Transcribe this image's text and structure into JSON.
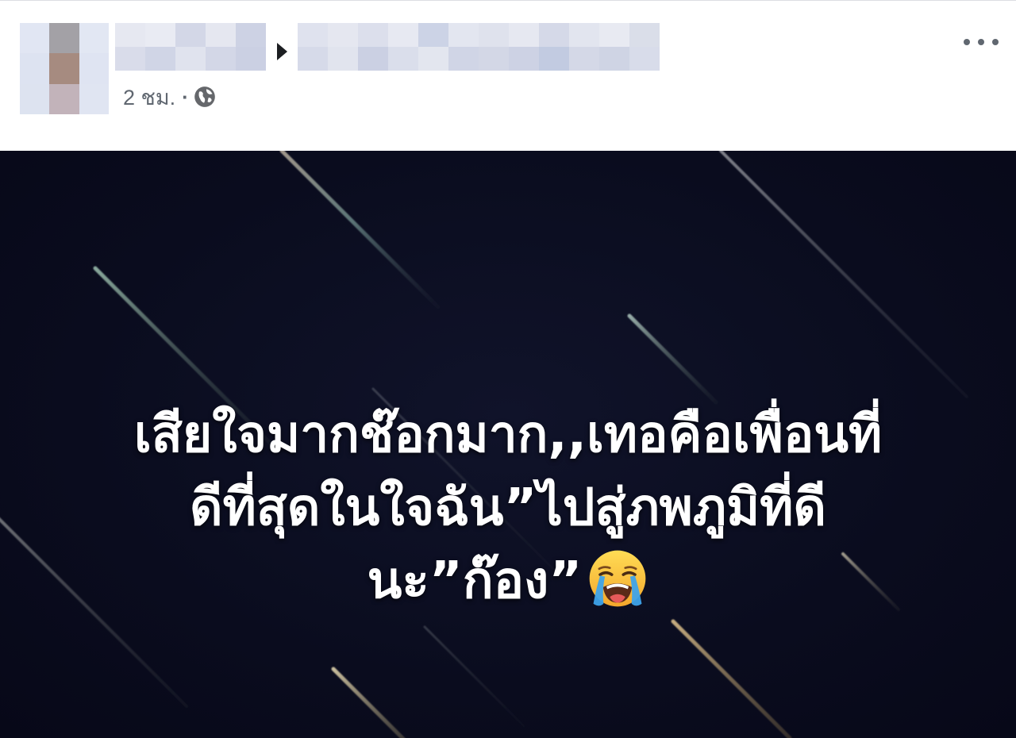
{
  "post": {
    "header": {
      "timestamp": "2 ชม.",
      "separator": "·",
      "icons": {
        "shared_to_arrow": "caret-right-icon",
        "privacy": "globe-icon",
        "more_options": "more-options-icon"
      }
    },
    "image": {
      "text_lines": [
        "เสียใจมากช๊อกมาก,,เทอคือเพื่อนที่",
        "ดีที่สุดในใจฉัน”ไปสู่ภพภูมิที่ดี",
        "นะ”ก๊อง”"
      ],
      "emoji_icon": "loudly-crying-face-icon"
    }
  },
  "colors": {
    "header_background": "#ffffff",
    "meta_text": "#606770",
    "image_background": "#0a0c1e",
    "post_text": "#ffffff"
  }
}
